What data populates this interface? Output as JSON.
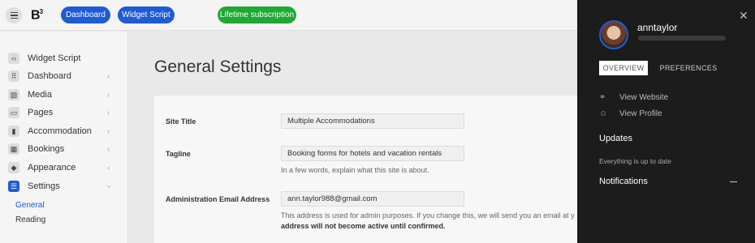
{
  "topbar": {
    "logo": "B",
    "logo_sup": "3",
    "dashboard_button": "Dashboard",
    "widget_script_button": "Widget Script",
    "subscription_badge": "Lifetime subscription"
  },
  "sidebar": {
    "items": [
      {
        "label": "Widget Script",
        "icon": "code-icon",
        "glyph": "‹›"
      },
      {
        "label": "Dashboard",
        "icon": "grid-icon",
        "glyph": "⠿"
      },
      {
        "label": "Media",
        "icon": "image-icon",
        "glyph": "▧"
      },
      {
        "label": "Pages",
        "icon": "pages-icon",
        "glyph": "▭"
      },
      {
        "label": "Accommodation",
        "icon": "building-icon",
        "glyph": "▮"
      },
      {
        "label": "Bookings",
        "icon": "calendar-icon",
        "glyph": "▦"
      },
      {
        "label": "Appearance",
        "icon": "paint-bucket-icon",
        "glyph": "◆"
      },
      {
        "label": "Settings",
        "icon": "sliders-icon",
        "glyph": "☰"
      }
    ],
    "sub_items": [
      {
        "label": "General",
        "active": true
      },
      {
        "label": "Reading",
        "active": false
      }
    ]
  },
  "main": {
    "title": "General Settings",
    "fields": [
      {
        "label": "Site Title",
        "value": "Multiple Accommodations"
      },
      {
        "label": "Tagline",
        "value": "Booking forms for hotels and vacation rentals",
        "hint": "In a few words, explain what this site is about."
      },
      {
        "label": "Administration Email Address",
        "value": "ann.taylor988@gmail.com",
        "hint_line1": "This address is used for admin purposes. If you change this, we will send you an email at y",
        "hint_line2": "address will not become active until confirmed."
      }
    ]
  },
  "panel": {
    "username": "anntaylor",
    "tabs": [
      "OVERVIEW",
      "PREFERENCES"
    ],
    "links": [
      {
        "label": "View Website",
        "icon": "link-icon",
        "glyph": "🔗"
      },
      {
        "label": "View Profile",
        "icon": "user-icon",
        "glyph": "👤"
      }
    ],
    "updates_heading": "Updates",
    "updates_text": "Everything is up to date",
    "notifications_heading": "Notifications",
    "close_glyph": "✕"
  },
  "colors": {
    "accent_blue": "#1f5bd6",
    "accent_green": "#1fa832",
    "panel_bg": "#1c1c1c"
  }
}
